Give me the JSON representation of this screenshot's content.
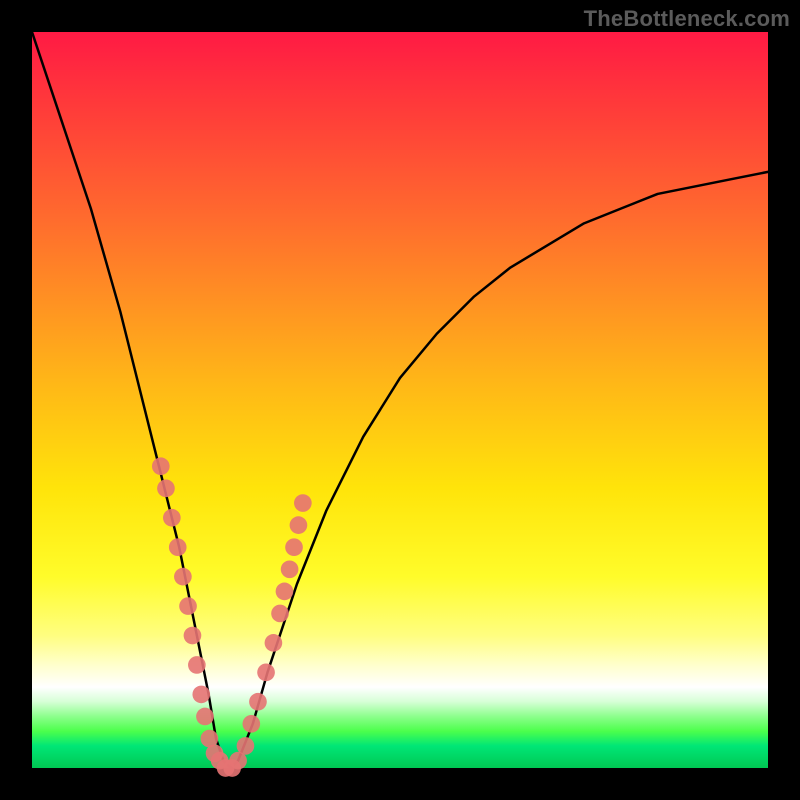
{
  "watermark": "TheBottleneck.com",
  "chart_data": {
    "type": "line",
    "title": "",
    "xlabel": "",
    "ylabel": "",
    "xlim": [
      0,
      100
    ],
    "ylim": [
      0,
      100
    ],
    "grid": false,
    "series": [
      {
        "name": "bottleneck-curve",
        "color": "#000000",
        "x": [
          0,
          4,
          8,
          12,
          16,
          18,
          20,
          22,
          24,
          25,
          26,
          27,
          28,
          30,
          32,
          36,
          40,
          45,
          50,
          55,
          60,
          65,
          70,
          75,
          80,
          85,
          90,
          95,
          100
        ],
        "y": [
          100,
          88,
          76,
          62,
          46,
          38,
          30,
          20,
          10,
          4,
          1,
          0,
          1,
          6,
          13,
          25,
          35,
          45,
          53,
          59,
          64,
          68,
          71,
          74,
          76,
          78,
          79,
          80,
          81
        ]
      }
    ],
    "markers": {
      "name": "highlighted-points",
      "color": "#e57373",
      "radius_plot_units": 1.2,
      "x": [
        17.5,
        18.2,
        19.0,
        19.8,
        20.5,
        21.2,
        21.8,
        22.4,
        23.0,
        23.5,
        24.1,
        24.8,
        25.5,
        26.3,
        27.2,
        28.0,
        29.0,
        29.8,
        30.7,
        31.8,
        32.8,
        33.7,
        34.3,
        35.0,
        35.6,
        36.2,
        36.8
      ],
      "y": [
        41,
        38,
        34,
        30,
        26,
        22,
        18,
        14,
        10,
        7,
        4,
        2,
        1,
        0,
        0,
        1,
        3,
        6,
        9,
        13,
        17,
        21,
        24,
        27,
        30,
        33,
        36
      ]
    }
  }
}
